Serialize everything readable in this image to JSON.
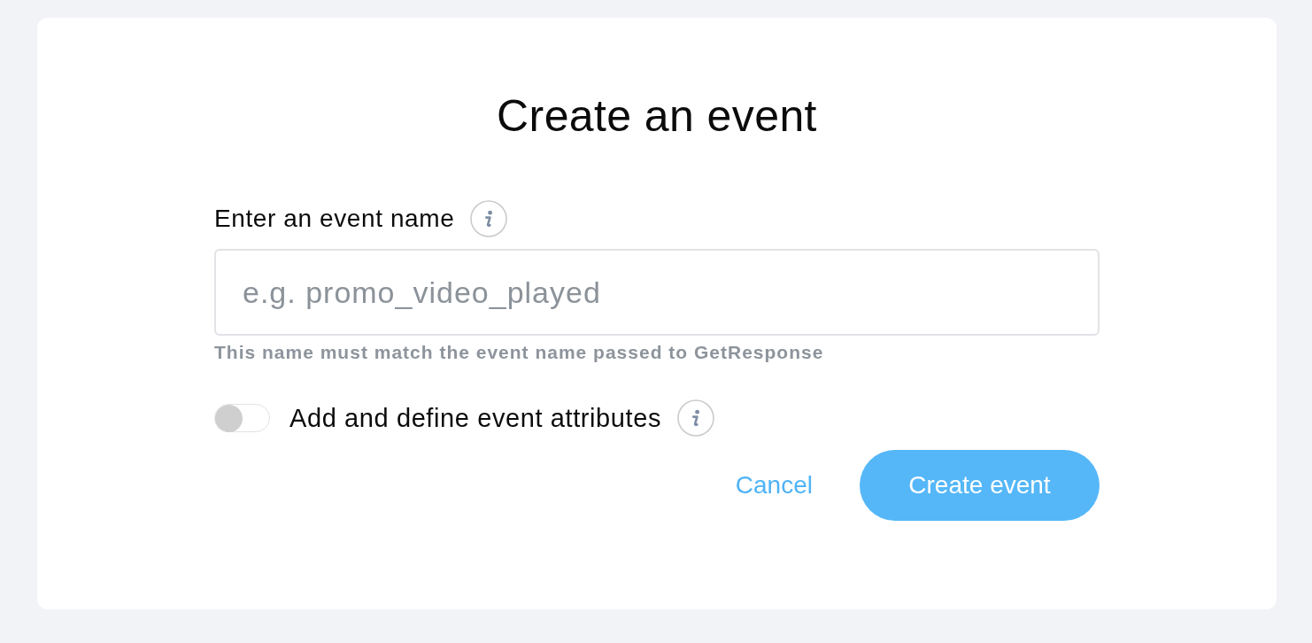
{
  "dialog": {
    "title": "Create an event"
  },
  "name_field": {
    "label": "Enter an event name",
    "placeholder": "e.g. promo_video_played",
    "hint": "This name must match the event name passed to GetResponse"
  },
  "attributes_toggle": {
    "label": "Add and define event attributes",
    "on": false
  },
  "buttons": [
    {
      "label": "Cancel",
      "kind": "link"
    },
    {
      "label": "Create event",
      "kind": "primary"
    }
  ]
}
